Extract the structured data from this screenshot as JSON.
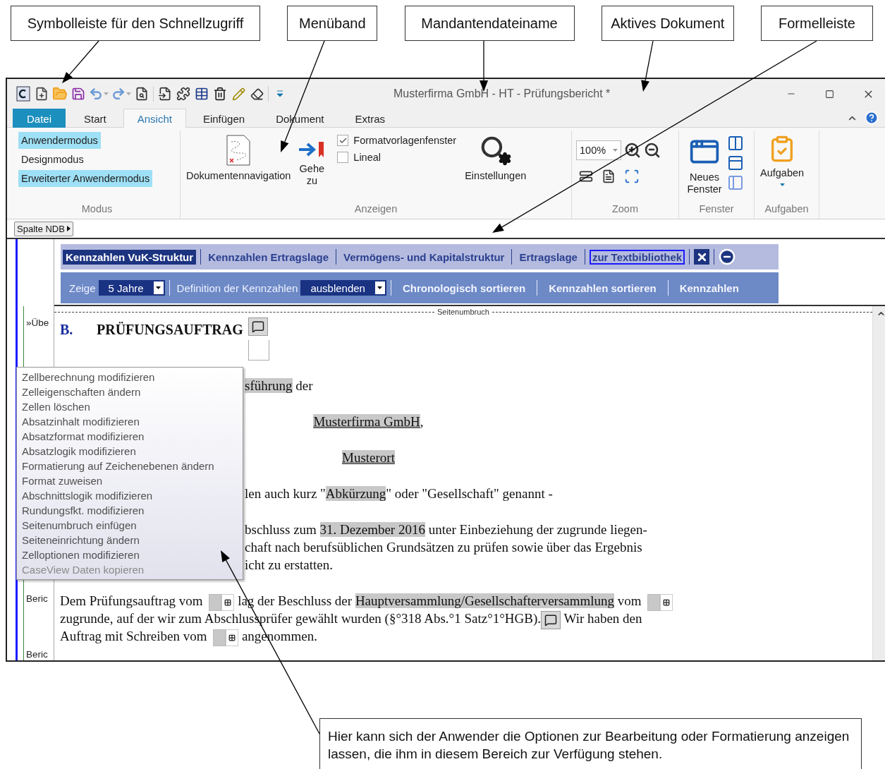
{
  "annotations": [
    {
      "text": "Symbolleiste für den Schnellzugriff"
    },
    {
      "text": "Menüband"
    },
    {
      "text": "Mandantendateiname"
    },
    {
      "text": "Aktives Dokument"
    },
    {
      "text": "Formelleiste"
    }
  ],
  "window": {
    "title": "Musterfirma GmbH - HT - Prüfungsbericht *"
  },
  "ribbon_tabs": [
    {
      "label": "Datei",
      "kind": "file",
      "selected": false
    },
    {
      "label": "Start",
      "kind": "tab",
      "selected": false
    },
    {
      "label": "Ansicht",
      "kind": "tab",
      "selected": true
    },
    {
      "label": "Einfügen",
      "kind": "tab",
      "selected": false
    },
    {
      "label": "Dokument",
      "kind": "tab",
      "selected": false
    },
    {
      "label": "Extras",
      "kind": "tab",
      "selected": false
    }
  ],
  "ribbon": {
    "modus": {
      "label": "Modus",
      "items": [
        {
          "label": "Anwendermodus",
          "selected": true
        },
        {
          "label": "Designmodus",
          "selected": false
        },
        {
          "label": "Erweiterter Anwendermodus",
          "selected": true
        }
      ]
    },
    "anzeigen": {
      "label": "Anzeigen",
      "navigation": "Dokumentennavigation",
      "goto": "Gehe zu",
      "checkboxes": [
        {
          "label": "Formatvorlagenfenster",
          "checked": true
        },
        {
          "label": "Lineal",
          "checked": false
        }
      ],
      "settings": "Einstellungen"
    },
    "zoom": {
      "label": "Zoom",
      "value": "100%"
    },
    "fenster": {
      "label": "Fenster",
      "new_window": "Neues Fenster"
    },
    "aufgaben": {
      "label": "Aufgaben",
      "button": "Aufgaben"
    }
  },
  "formula_bar": {
    "button": "Spalte NDB"
  },
  "nav_links": [
    {
      "label": "Kennzahlen VuK-Struktur",
      "selected": true,
      "focused": false
    },
    {
      "label": "Kennzahlen Ertragslage",
      "selected": false,
      "focused": false
    },
    {
      "label": "Vermögens- und Kapitalstruktur",
      "selected": false,
      "focused": false
    },
    {
      "label": "Ertragslage",
      "selected": false,
      "focused": false
    },
    {
      "label": "zur Textbibliothek",
      "selected": false,
      "focused": true
    }
  ],
  "nav_toolbar": [
    {
      "kind": "label",
      "text": "Zeige"
    },
    {
      "kind": "select",
      "text": "5 Jahre"
    },
    {
      "kind": "label",
      "text": "Definition der Kennzahlen"
    },
    {
      "kind": "select",
      "text": "ausblenden"
    },
    {
      "kind": "link",
      "text": "Chronologisch sortieren"
    },
    {
      "kind": "link",
      "text": "Kennzahlen sortieren"
    },
    {
      "kind": "link",
      "text": "Kennzahlen"
    }
  ],
  "page_break": "Seitenumbruch",
  "document": [
    {
      "kind": "heading",
      "gutter": "»Übe",
      "number": "B.",
      "title": "PRÜFUNGSAUFTRAG"
    },
    {
      "kind": "paragraph",
      "lines": [
        {
          "centered": false,
          "covered": true,
          "segments": [
            {
              "kind": "field",
              "text": "sführung",
              "underline": false
            },
            {
              "kind": "text",
              "text": " der"
            }
          ]
        }
      ]
    },
    {
      "kind": "paragraph",
      "lines": [
        {
          "centered": true,
          "segments": [
            {
              "kind": "field",
              "text": "Musterfirma GmbH",
              "underline": true
            },
            {
              "kind": "text",
              "text": ","
            }
          ]
        }
      ]
    },
    {
      "kind": "paragraph",
      "lines": [
        {
          "centered": true,
          "segments": [
            {
              "kind": "field",
              "text": "Musterort",
              "underline": true
            }
          ]
        }
      ]
    },
    {
      "kind": "paragraph",
      "lines": [
        {
          "centered": false,
          "covered": true,
          "segments": [
            {
              "kind": "text",
              "text": "len auch kurz \""
            },
            {
              "kind": "field",
              "text": "Abkürzung",
              "underline": false
            },
            {
              "kind": "text",
              "text": "\" oder \"Gesellschaft\" genannt -"
            }
          ]
        }
      ]
    },
    {
      "kind": "paragraph",
      "lines": [
        {
          "centered": false,
          "covered": true,
          "segments": [
            {
              "kind": "text",
              "text": "bschluss zum "
            },
            {
              "kind": "field",
              "text": "31. Dezember 2016",
              "underline": false
            },
            {
              "kind": "text",
              "text": " unter Einbeziehung der zugrunde liegen-"
            }
          ]
        },
        {
          "centered": false,
          "covered": true,
          "segments": [
            {
              "kind": "text",
              "text": "chaft nach berufsüblichen Grundsätzen zu prüfen sowie über das Ergebnis"
            }
          ]
        },
        {
          "centered": false,
          "covered": true,
          "segments": [
            {
              "kind": "text",
              "text": "icht zu erstatten."
            }
          ]
        }
      ]
    },
    {
      "kind": "paragraph",
      "gutter": "Beric",
      "lines": [
        {
          "centered": false,
          "covered": false,
          "segments": [
            {
              "kind": "text",
              "text": "Dem Prüfungsauftrag vom "
            },
            {
              "kind": "date_field"
            },
            {
              "kind": "text",
              "text": " lag der Beschluss der "
            },
            {
              "kind": "field",
              "text": "Hauptversammlung/Gesellschafterversammlung",
              "underline": false
            },
            {
              "kind": "text",
              "text": " vom "
            },
            {
              "kind": "date_field"
            }
          ]
        },
        {
          "centered": false,
          "covered": false,
          "segments": [
            {
              "kind": "text",
              "text": "zugrunde, auf der wir zum Abschlussprüfer gewählt wurden (§°318 Abs.°1 Satz°1°HGB)."
            },
            {
              "kind": "help"
            },
            {
              "kind": "text",
              "text": " Wir haben den"
            }
          ]
        },
        {
          "centered": false,
          "covered": false,
          "segments": [
            {
              "kind": "text",
              "text": "Auftrag mit Schreiben vom "
            },
            {
              "kind": "date_field"
            },
            {
              "kind": "text",
              "text": " angenommen."
            }
          ]
        }
      ]
    },
    {
      "kind": "paragraph",
      "gutter": "Beric"
    }
  ],
  "context_menu": [
    {
      "label": "Zellberechnung modifizieren",
      "disabled": false
    },
    {
      "label": "Zelleigenschaften ändern",
      "disabled": false
    },
    {
      "label": "Zellen löschen",
      "disabled": false
    },
    {
      "label": "Absatzinhalt modifizieren",
      "disabled": false
    },
    {
      "label": "Absatzformat modifizieren",
      "disabled": false
    },
    {
      "label": "Absatzlogik modifizieren",
      "disabled": false
    },
    {
      "label": "Formatierung auf Zeichenebenen ändern",
      "disabled": false
    },
    {
      "label": "Format zuweisen",
      "disabled": false
    },
    {
      "label": "Abschnittslogik modifizieren",
      "disabled": false
    },
    {
      "label": "Rundungsfkt. modifizieren",
      "disabled": false
    },
    {
      "label": "Seitenumbruch einfügen",
      "disabled": false
    },
    {
      "label": "Seiteneinrichtung ändern",
      "disabled": false
    },
    {
      "label": "Zelloptionen modifizieren",
      "disabled": false
    },
    {
      "label": "CaseView Daten kopieren",
      "disabled": true
    }
  ],
  "note": "Hier kann sich der Anwender die Optionen zur Bearbeitung oder Formatierung anzeigen lassen, die ihm in diesem Bereich zur Verfügung stehen."
}
